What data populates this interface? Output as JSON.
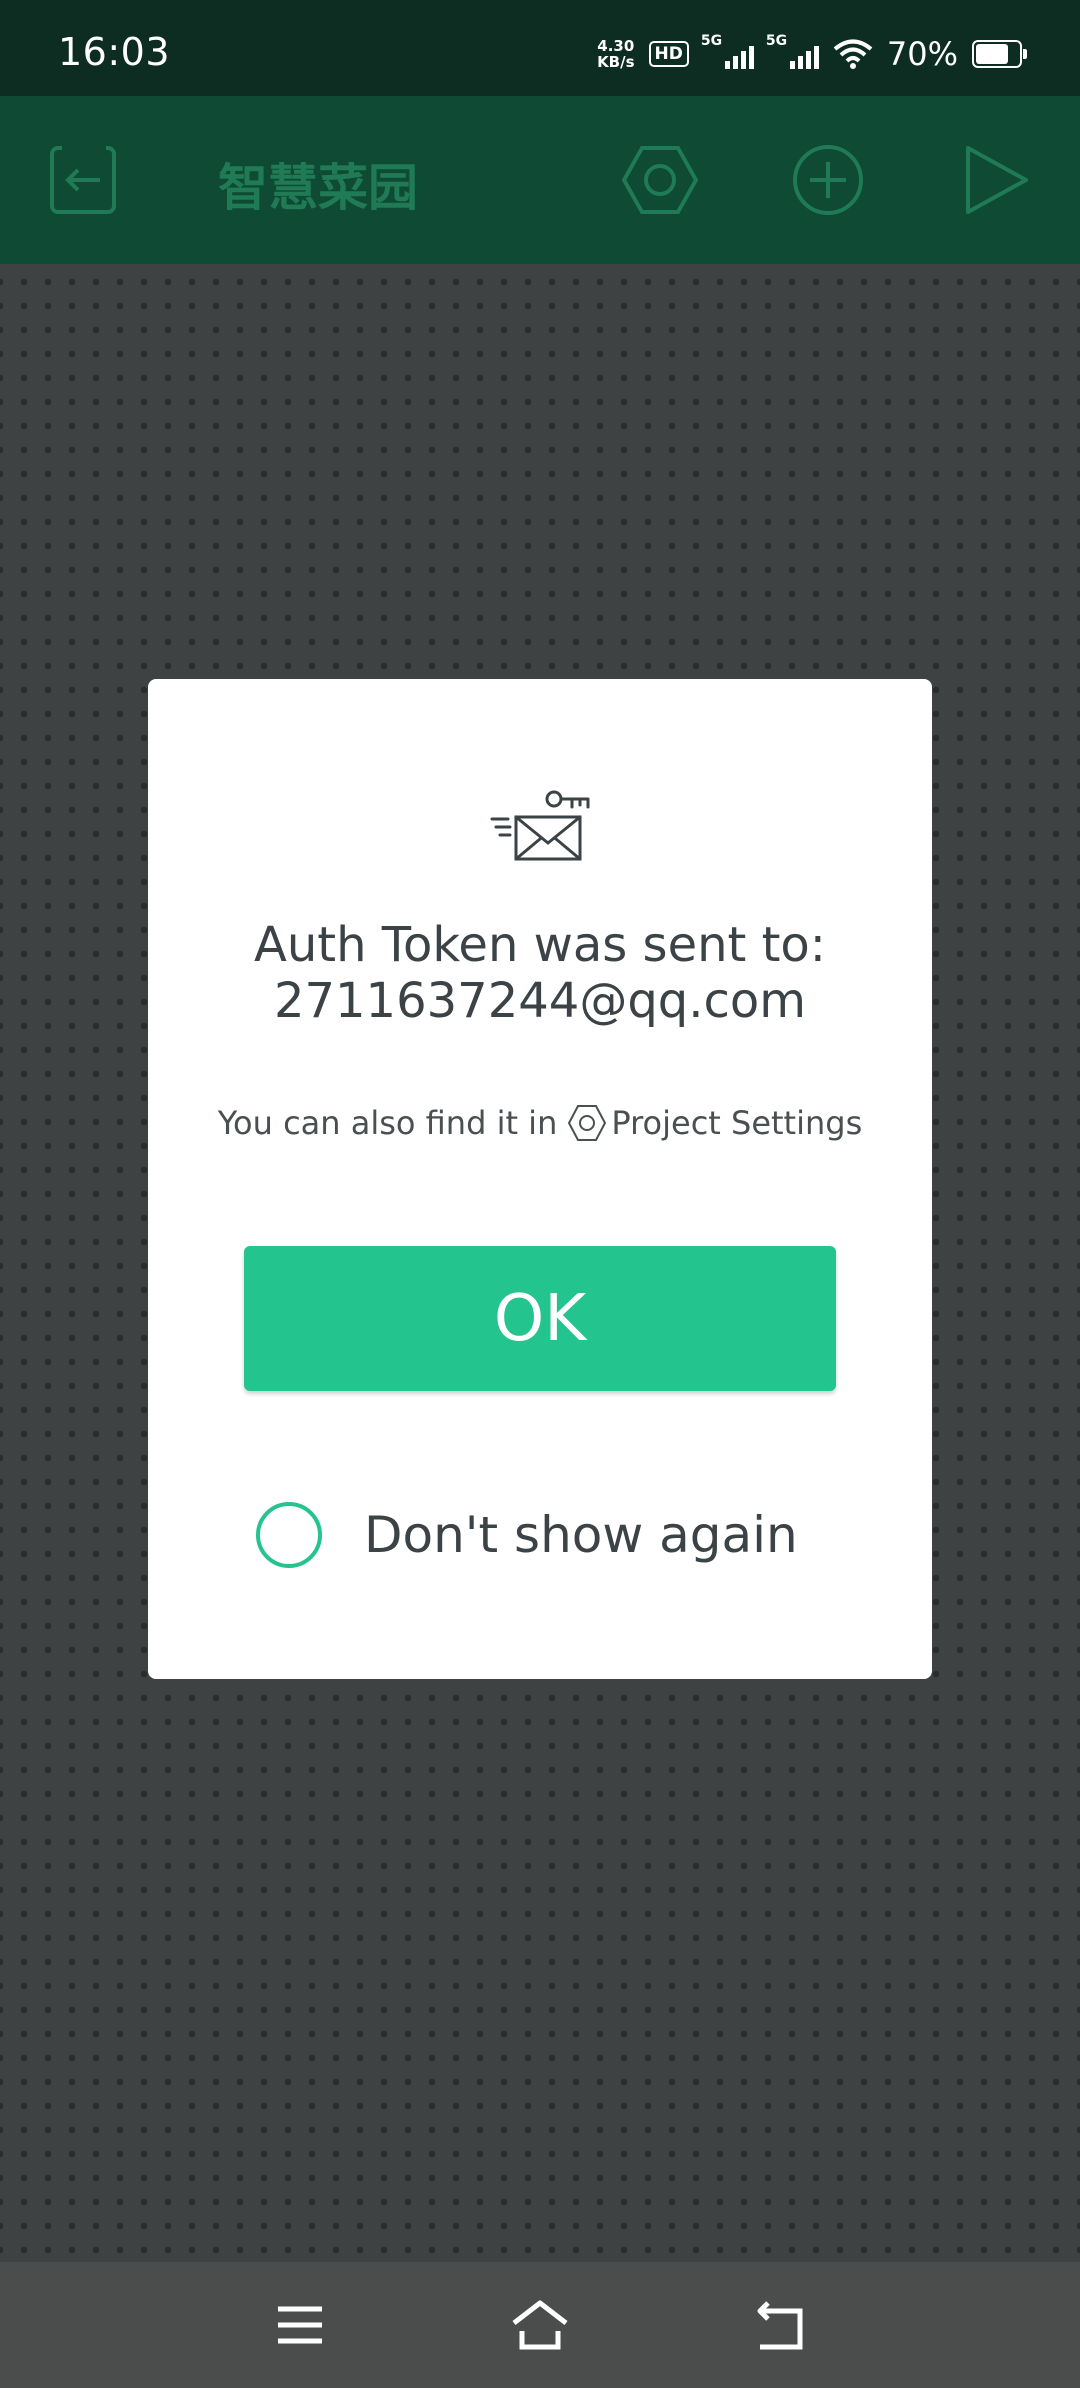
{
  "status_bar": {
    "time": "16:03",
    "net_speed_value": "4.30",
    "net_speed_unit": "KB/s",
    "hd_label": "HD",
    "sim1_label": "5G",
    "sim2_label": "5G",
    "battery_percent": "70%"
  },
  "app_bar": {
    "title": "智慧菜园"
  },
  "dialog": {
    "title_line1": "Auth Token was sent to:",
    "title_line2": "2711637244@qq.com",
    "hint_prefix": "You can also find it in",
    "hint_link": "Project Settings",
    "ok_label": "OK",
    "dont_show_label": "Don't show again",
    "dont_show_checked": false
  },
  "colors": {
    "accent": "#23c48e",
    "app_bar": "#0e4a34",
    "status_bar": "#0d2d22",
    "overlay_canvas": "#3f4242"
  },
  "icons": {
    "app_bar": [
      "exit-icon",
      "settings-hexagon-icon",
      "add-icon",
      "play-icon"
    ],
    "dialog": "mail-key-icon",
    "nav": [
      "menu-icon",
      "home-icon",
      "back-icon"
    ]
  }
}
